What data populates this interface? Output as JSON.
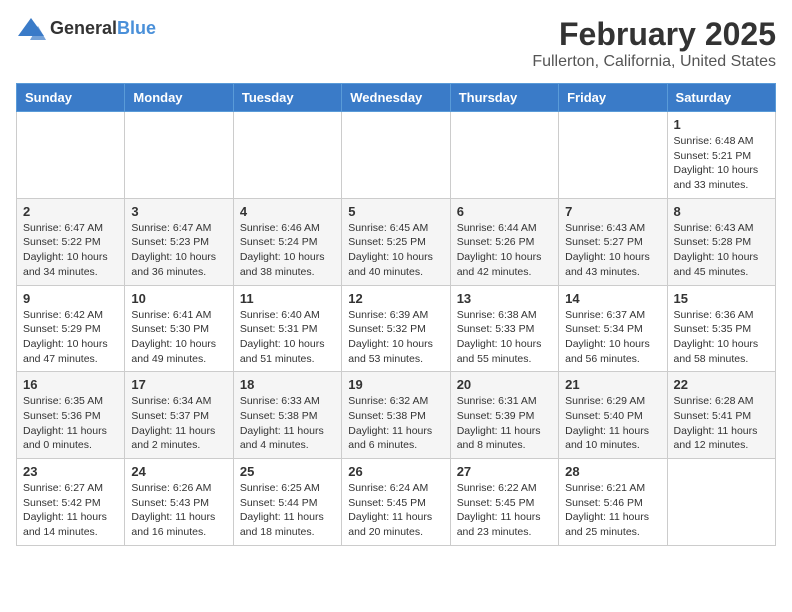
{
  "header": {
    "logo_general": "General",
    "logo_blue": "Blue",
    "month": "February 2025",
    "location": "Fullerton, California, United States"
  },
  "days_of_week": [
    "Sunday",
    "Monday",
    "Tuesday",
    "Wednesday",
    "Thursday",
    "Friday",
    "Saturday"
  ],
  "weeks": [
    [
      {
        "day": "",
        "info": ""
      },
      {
        "day": "",
        "info": ""
      },
      {
        "day": "",
        "info": ""
      },
      {
        "day": "",
        "info": ""
      },
      {
        "day": "",
        "info": ""
      },
      {
        "day": "",
        "info": ""
      },
      {
        "day": "1",
        "info": "Sunrise: 6:48 AM\nSunset: 5:21 PM\nDaylight: 10 hours\nand 33 minutes."
      }
    ],
    [
      {
        "day": "2",
        "info": "Sunrise: 6:47 AM\nSunset: 5:22 PM\nDaylight: 10 hours\nand 34 minutes."
      },
      {
        "day": "3",
        "info": "Sunrise: 6:47 AM\nSunset: 5:23 PM\nDaylight: 10 hours\nand 36 minutes."
      },
      {
        "day": "4",
        "info": "Sunrise: 6:46 AM\nSunset: 5:24 PM\nDaylight: 10 hours\nand 38 minutes."
      },
      {
        "day": "5",
        "info": "Sunrise: 6:45 AM\nSunset: 5:25 PM\nDaylight: 10 hours\nand 40 minutes."
      },
      {
        "day": "6",
        "info": "Sunrise: 6:44 AM\nSunset: 5:26 PM\nDaylight: 10 hours\nand 42 minutes."
      },
      {
        "day": "7",
        "info": "Sunrise: 6:43 AM\nSunset: 5:27 PM\nDaylight: 10 hours\nand 43 minutes."
      },
      {
        "day": "8",
        "info": "Sunrise: 6:43 AM\nSunset: 5:28 PM\nDaylight: 10 hours\nand 45 minutes."
      }
    ],
    [
      {
        "day": "9",
        "info": "Sunrise: 6:42 AM\nSunset: 5:29 PM\nDaylight: 10 hours\nand 47 minutes."
      },
      {
        "day": "10",
        "info": "Sunrise: 6:41 AM\nSunset: 5:30 PM\nDaylight: 10 hours\nand 49 minutes."
      },
      {
        "day": "11",
        "info": "Sunrise: 6:40 AM\nSunset: 5:31 PM\nDaylight: 10 hours\nand 51 minutes."
      },
      {
        "day": "12",
        "info": "Sunrise: 6:39 AM\nSunset: 5:32 PM\nDaylight: 10 hours\nand 53 minutes."
      },
      {
        "day": "13",
        "info": "Sunrise: 6:38 AM\nSunset: 5:33 PM\nDaylight: 10 hours\nand 55 minutes."
      },
      {
        "day": "14",
        "info": "Sunrise: 6:37 AM\nSunset: 5:34 PM\nDaylight: 10 hours\nand 56 minutes."
      },
      {
        "day": "15",
        "info": "Sunrise: 6:36 AM\nSunset: 5:35 PM\nDaylight: 10 hours\nand 58 minutes."
      }
    ],
    [
      {
        "day": "16",
        "info": "Sunrise: 6:35 AM\nSunset: 5:36 PM\nDaylight: 11 hours\nand 0 minutes."
      },
      {
        "day": "17",
        "info": "Sunrise: 6:34 AM\nSunset: 5:37 PM\nDaylight: 11 hours\nand 2 minutes."
      },
      {
        "day": "18",
        "info": "Sunrise: 6:33 AM\nSunset: 5:38 PM\nDaylight: 11 hours\nand 4 minutes."
      },
      {
        "day": "19",
        "info": "Sunrise: 6:32 AM\nSunset: 5:38 PM\nDaylight: 11 hours\nand 6 minutes."
      },
      {
        "day": "20",
        "info": "Sunrise: 6:31 AM\nSunset: 5:39 PM\nDaylight: 11 hours\nand 8 minutes."
      },
      {
        "day": "21",
        "info": "Sunrise: 6:29 AM\nSunset: 5:40 PM\nDaylight: 11 hours\nand 10 minutes."
      },
      {
        "day": "22",
        "info": "Sunrise: 6:28 AM\nSunset: 5:41 PM\nDaylight: 11 hours\nand 12 minutes."
      }
    ],
    [
      {
        "day": "23",
        "info": "Sunrise: 6:27 AM\nSunset: 5:42 PM\nDaylight: 11 hours\nand 14 minutes."
      },
      {
        "day": "24",
        "info": "Sunrise: 6:26 AM\nSunset: 5:43 PM\nDaylight: 11 hours\nand 16 minutes."
      },
      {
        "day": "25",
        "info": "Sunrise: 6:25 AM\nSunset: 5:44 PM\nDaylight: 11 hours\nand 18 minutes."
      },
      {
        "day": "26",
        "info": "Sunrise: 6:24 AM\nSunset: 5:45 PM\nDaylight: 11 hours\nand 20 minutes."
      },
      {
        "day": "27",
        "info": "Sunrise: 6:22 AM\nSunset: 5:45 PM\nDaylight: 11 hours\nand 23 minutes."
      },
      {
        "day": "28",
        "info": "Sunrise: 6:21 AM\nSunset: 5:46 PM\nDaylight: 11 hours\nand 25 minutes."
      },
      {
        "day": "",
        "info": ""
      }
    ]
  ]
}
